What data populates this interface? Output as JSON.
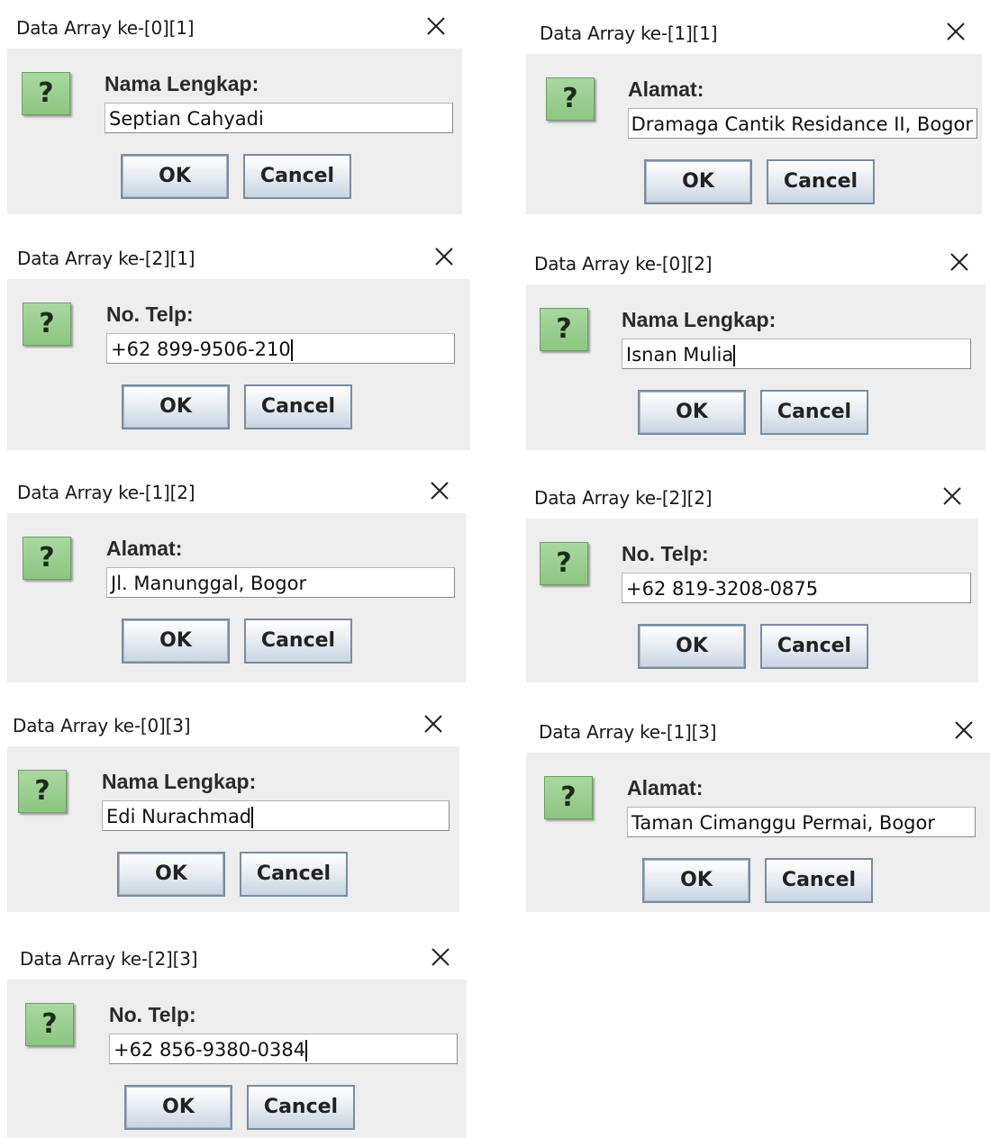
{
  "dialogs": [
    {
      "title": "Data Array ke-[0][1]",
      "label": "Nama Lengkap:",
      "value": "Septian Cahyadi",
      "ok": "OK",
      "cancel": "Cancel"
    },
    {
      "title": "Data Array ke-[1][1]",
      "label": "Alamat:",
      "value": "Dramaga Cantik Residance II, Bogor",
      "ok": "OK",
      "cancel": "Cancel"
    },
    {
      "title": "Data Array ke-[2][1]",
      "label": "No. Telp:",
      "value": "+62 899-9506-210",
      "ok": "OK",
      "cancel": "Cancel"
    },
    {
      "title": "Data Array ke-[0][2]",
      "label": "Nama Lengkap:",
      "value": "Isnan Mulia",
      "ok": "OK",
      "cancel": "Cancel"
    },
    {
      "title": "Data Array ke-[1][2]",
      "label": "Alamat:",
      "value": "Jl. Manunggal, Bogor",
      "ok": "OK",
      "cancel": "Cancel"
    },
    {
      "title": "Data Array ke-[2][2]",
      "label": "No. Telp:",
      "value": "+62 819-3208-0875",
      "ok": "OK",
      "cancel": "Cancel"
    },
    {
      "title": "Data Array ke-[0][3]",
      "label": "Nama Lengkap:",
      "value": "Edi Nurachmad",
      "ok": "OK",
      "cancel": "Cancel"
    },
    {
      "title": "Data Array ke-[1][3]",
      "label": "Alamat:",
      "value": "Taman Cimanggu Permai, Bogor",
      "ok": "OK",
      "cancel": "Cancel"
    },
    {
      "title": "Data Array ke-[2][3]",
      "label": "No. Telp:",
      "value": "+62 856-9380-0384",
      "ok": "OK",
      "cancel": "Cancel"
    }
  ],
  "icons": {
    "question": "question-icon",
    "close": "close-icon"
  },
  "colors": {
    "icon_bg": "#9ccf92",
    "panel_bg": "#eeeeee",
    "button_border": "#7a8ca0"
  }
}
